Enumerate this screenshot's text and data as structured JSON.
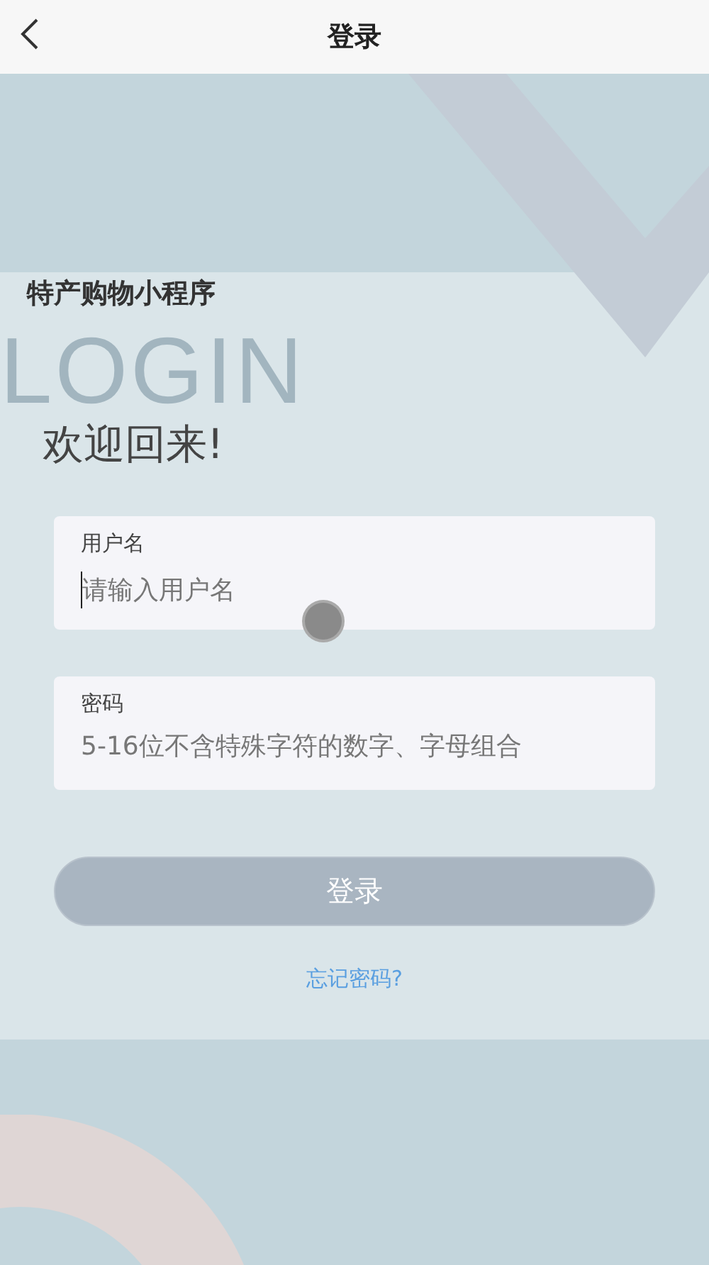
{
  "header": {
    "title": "登录"
  },
  "brand": "特产购物小程序",
  "backdrop_text": "LOGIN",
  "welcome": "欢迎回来!",
  "fields": [
    {
      "label": "用户名",
      "placeholder": "请输入用户名",
      "focused": true
    },
    {
      "label": "密码",
      "placeholder": "5-16位不含特殊字符的数字、字母组合",
      "focused": false
    }
  ],
  "submit": {
    "label": "登录",
    "disabled": true
  },
  "forgot_link": "忘记密码?"
}
